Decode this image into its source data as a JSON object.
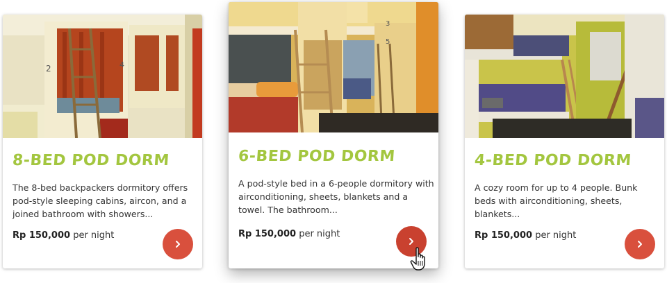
{
  "cards": [
    {
      "title": "8-Bed Pod Dorm",
      "description": "The 8-bed backpackers dormitory offers pod-style sleeping cabins, aircon, and a joined bathroom with showers...",
      "price": "Rp 150,000",
      "price_suffix": " per night",
      "photo_icon": "dorm-photo",
      "button_icon": "chevron-right-icon"
    },
    {
      "title": "6-Bed Pod Dorm",
      "description": "A pod-style bed in a 6-people dormitory with airconditioning, sheets, blankets and a towel. The bathroom...",
      "price": "Rp 150,000",
      "price_suffix": " per night",
      "photo_icon": "dorm-photo",
      "button_icon": "chevron-right-icon"
    },
    {
      "title": "4-Bed Pod Dorm",
      "description": "A cozy room for up to 4 people. Bunk beds with airconditioning, sheets, blankets...",
      "price": "Rp 150,000",
      "price_suffix": " per night",
      "photo_icon": "dorm-photo",
      "button_icon": "chevron-right-icon"
    }
  ],
  "photo_labels": {
    "pod_numbers_card1": [
      "2",
      "4"
    ],
    "pod_numbers_card2": [
      "3",
      "5"
    ]
  },
  "colors": {
    "title_green": "#a3c63f",
    "button_red": "#d9503d",
    "button_red_hover": "#c9412f"
  },
  "cursor_icon": "hand-pointer-icon"
}
